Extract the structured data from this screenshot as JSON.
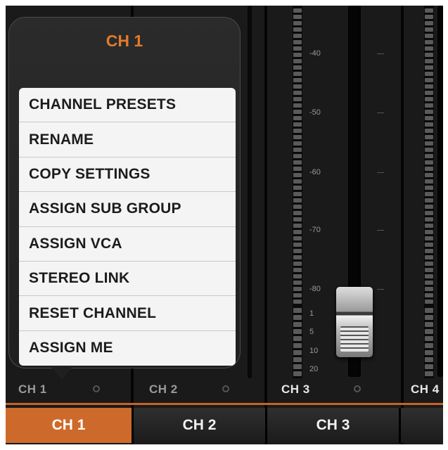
{
  "popup": {
    "title": "CH 1",
    "items": [
      {
        "label": "CHANNEL PRESETS"
      },
      {
        "label": "RENAME"
      },
      {
        "label": "COPY SETTINGS"
      },
      {
        "label": "ASSIGN SUB GROUP"
      },
      {
        "label": "ASSIGN VCA"
      },
      {
        "label": "STEREO LINK"
      },
      {
        "label": "RESET CHANNEL"
      },
      {
        "label": "ASSIGN ME"
      }
    ]
  },
  "strips": {
    "ch1_label": "CH 1",
    "ch2_label": "CH 2",
    "ch3_label": "CH 3",
    "ch4_label": "CH 4"
  },
  "fader_scale": [
    "-40",
    "-50",
    "-60",
    "-70",
    "-80"
  ],
  "meter_scale": [
    "1",
    "5",
    "10",
    "20"
  ],
  "tabs": [
    {
      "label": "CH 1",
      "active": true
    },
    {
      "label": "CH 2",
      "active": false
    },
    {
      "label": "CH 3",
      "active": false
    }
  ],
  "colors": {
    "accent": "#cd6a2b",
    "popup_title": "#e07b2e"
  }
}
